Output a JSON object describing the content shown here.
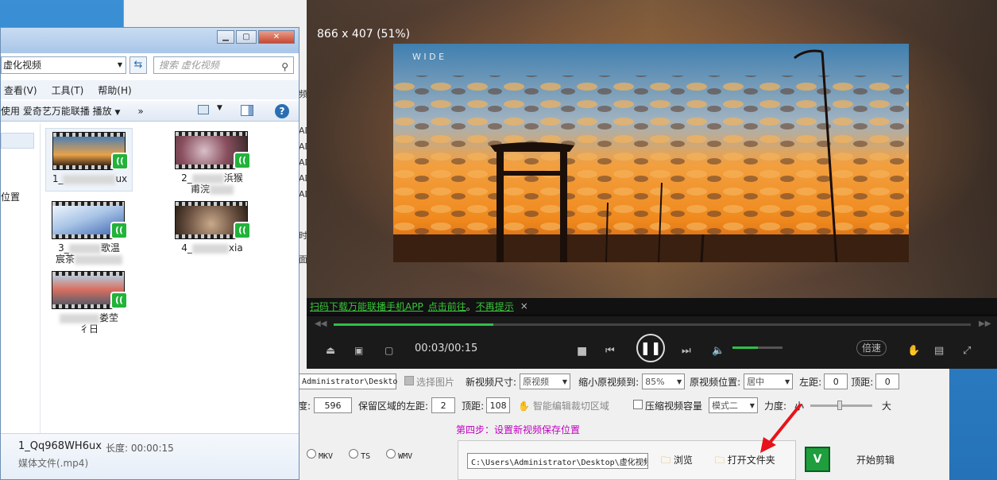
{
  "explorer": {
    "address": "虚化视频",
    "search_placeholder": "搜索 虚化视频",
    "menu": [
      "查看(V)",
      "工具(T)",
      "帮助(H)"
    ],
    "toolbar_label": "使用 爱奇艺万能联播 播放",
    "toolbar_more": "»",
    "nav_item": "位置",
    "files": [
      {
        "name_prefix": "1_",
        "name_suffix": "ux"
      },
      {
        "name_prefix": "2_",
        "name_suffix": "浜猴",
        "line2": "甫浣"
      },
      {
        "name_prefix": "3_",
        "name_suffix": "歌温",
        "line2": "宸茶"
      },
      {
        "name_prefix": "4_",
        "name_suffix": "xia"
      },
      {
        "name_prefix": "",
        "name_suffix": "娄茔",
        "line2": "彳日"
      }
    ],
    "details": {
      "filename": "1_Qq968WH6ux",
      "length_label": "长度: 00:00:15",
      "type": "媒体文件(.mp4)"
    }
  },
  "player": {
    "resolution": "866 x 407 (51%)",
    "watermark": "W I D E",
    "qr_link": "扫码下载万能联播手机APP",
    "go_link": "点击前往",
    "sep": "。",
    "no_remind": "不再提示",
    "close": "×",
    "time": "00:03/00:15",
    "progress": 0.25,
    "volume": 0.5,
    "speed_label": "倍速"
  },
  "editor": {
    "side_labels": [
      "频",
      "AD",
      "AD",
      "AD",
      "AD",
      "AD",
      "时",
      "面"
    ],
    "row1": {
      "path_fragment": "Administrator\\Deskto",
      "select_image": "选择图片",
      "new_size_label": "新视频尺寸:",
      "new_size_value": "原视频",
      "shrink_label": "缩小原视频到:",
      "shrink_value": "85%",
      "pos_label": "原视频位置:",
      "pos_value": "居中",
      "left_label": "左距:",
      "left_value": "0",
      "top_label": "顶距:",
      "top_value": "0"
    },
    "row2": {
      "degree_label": "度:",
      "degree_value": "596",
      "keep_left_label": "保留区域的左距:",
      "keep_left_value": "2",
      "top_label": "顶距:",
      "top_value": "108",
      "smart_crop": "智能编辑裁切区域",
      "compress_label": "压缩视频容量",
      "mode_value": "模式二",
      "force_label": "力度:",
      "small": "小",
      "big": "大"
    },
    "step4": "第四步：设置新视频保存位置",
    "formats": [
      "MKV",
      "TS",
      "WMV"
    ],
    "save_path": "C:\\Users\\Administrator\\Desktop\\虚化视频",
    "browse": "浏览",
    "open_folder": "打开文件夹",
    "start": "开始剪辑"
  }
}
